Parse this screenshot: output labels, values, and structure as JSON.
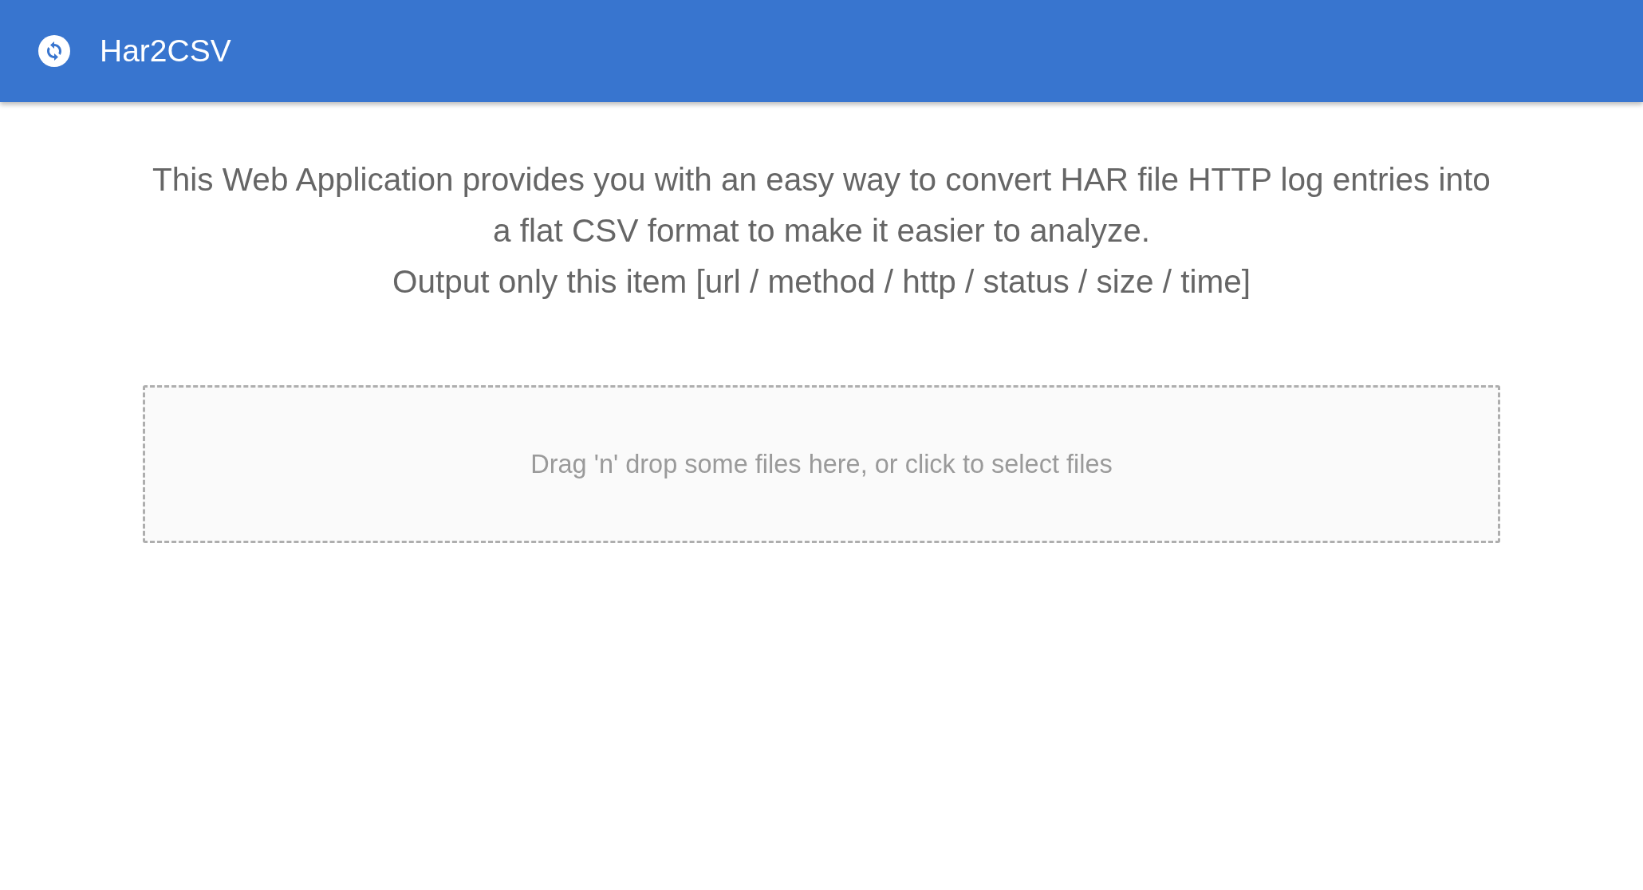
{
  "app_bar": {
    "title": "Har2CSV"
  },
  "intro": {
    "description": "This Web Application provides you with an easy way to convert HAR file HTTP log entries into a flat CSV format to make it easier to analyze.",
    "output_note": "Output only this item [url / method / http / status / size / time]"
  },
  "dropzone": {
    "text": "Drag 'n' drop some files here, or click to select files"
  }
}
